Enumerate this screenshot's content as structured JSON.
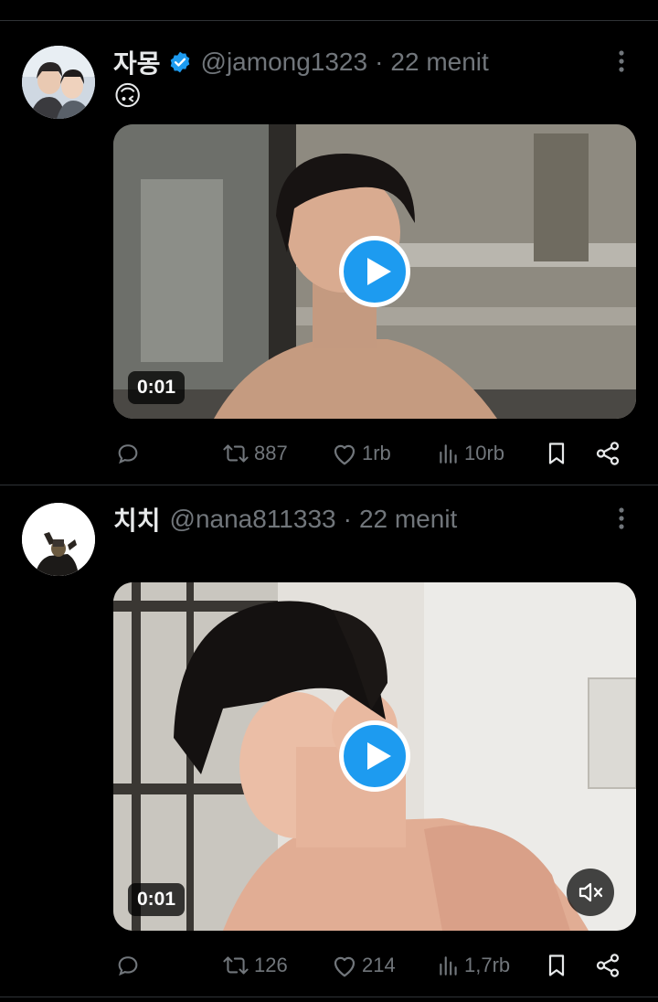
{
  "tweets": [
    {
      "name": "자몽",
      "verified": true,
      "handle": "@jamong1323",
      "separator": "·",
      "time": "22 menit",
      "text": "🙃",
      "video": {
        "duration": "0:01",
        "muted_indicator": false
      },
      "stats": {
        "retweets": "887",
        "likes": "1rb",
        "views": "10rb"
      }
    },
    {
      "name": "치치",
      "verified": false,
      "handle": "@nana811333",
      "separator": "·",
      "time": "22 menit",
      "text": "",
      "video": {
        "duration": "0:01",
        "muted_indicator": true
      },
      "stats": {
        "retweets": "126",
        "likes": "214",
        "views": "1,7rb"
      }
    }
  ],
  "colors": {
    "background": "#000000",
    "text_primary": "#e7e9ea",
    "text_secondary": "#71767b",
    "accent": "#1d9bf0",
    "divider": "#2f3336"
  },
  "icons": [
    "verified-badge-icon",
    "more-icon",
    "play-icon",
    "mute-icon",
    "reply-icon",
    "retweet-icon",
    "like-icon",
    "views-icon",
    "bookmark-icon",
    "share-icon"
  ]
}
